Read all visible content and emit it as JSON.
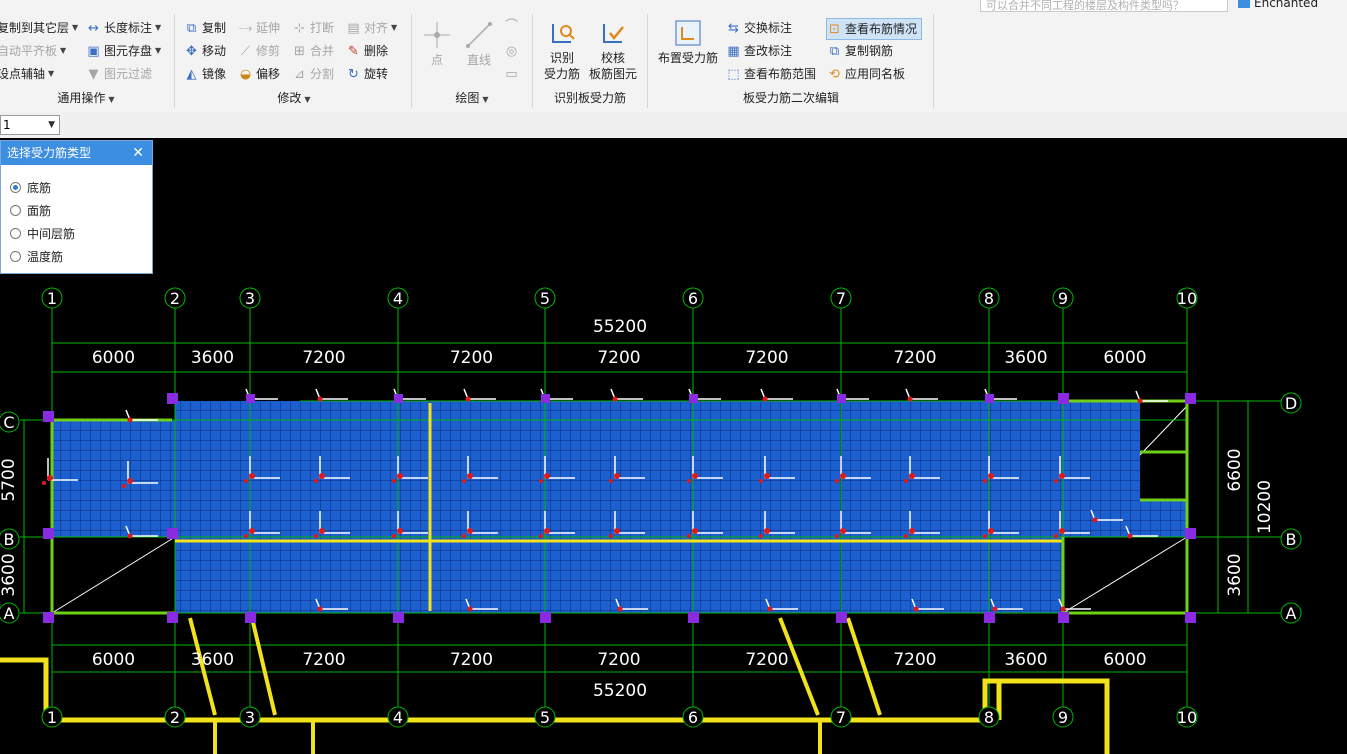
{
  "search": {
    "placeholder": "可以合并不同工程的楼层及构件类型吗？"
  },
  "user": {
    "name": "Enchanted"
  },
  "ribbon": {
    "general": {
      "items": [
        "复制到其它层",
        "自动平齐板",
        "设点辅轴"
      ],
      "items2": [
        "长度标注",
        "图元存盘",
        "图元过滤"
      ],
      "caption": "通用操作"
    },
    "modify": {
      "col1": [
        "复制",
        "移动",
        "镜像"
      ],
      "col2": [
        "延伸",
        "修剪",
        "偏移"
      ],
      "col3": [
        "打断",
        "合并",
        "分割"
      ],
      "col4": [
        "对齐",
        "删除",
        "旋转"
      ],
      "caption": "修改"
    },
    "draw": {
      "point": "点",
      "line": "直线",
      "caption": "绘图"
    },
    "identify": {
      "btn1_line1": "识别",
      "btn1_line2": "受力筋",
      "btn2_line1": "校核",
      "btn2_line2": "板筋图元",
      "caption": "识别板受力筋"
    },
    "edit": {
      "place": "布置受力筋",
      "col1": [
        "交换标注",
        "查改标注",
        "查看布筋范围"
      ],
      "col2": [
        "查看布筋情况",
        "复制钢筋",
        "应用同名板"
      ],
      "caption": "板受力筋二次编辑"
    }
  },
  "floor_selector": {
    "value": "1"
  },
  "panel": {
    "title": "选择受力筋类型",
    "close": "✕",
    "options": [
      "底筋",
      "面筋",
      "中间层筋",
      "温度筋"
    ],
    "selected": 0
  },
  "drawing": {
    "axes": [
      "1",
      "2",
      "3",
      "4",
      "5",
      "6",
      "7",
      "8",
      "9",
      "10"
    ],
    "rows": [
      "D",
      "C",
      "B",
      "A"
    ],
    "spacings": [
      "6000",
      "3600",
      "7200",
      "7200",
      "7200",
      "7200",
      "7200",
      "3600",
      "6000"
    ],
    "total": "55200",
    "left_dims": [
      "5700",
      "3600"
    ],
    "right_dims": [
      "6600",
      "3600",
      "10200"
    ],
    "colors": {
      "slab": "#1c5fcf",
      "grid": "#00b800",
      "beam": "#f2e21c",
      "column": "#8a2be2",
      "rebar": "#ffffff",
      "mark": "#e01818"
    }
  }
}
